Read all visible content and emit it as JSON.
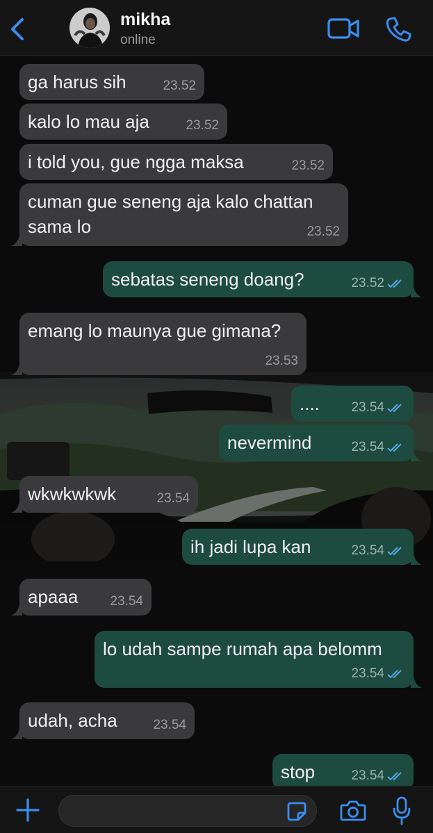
{
  "header": {
    "contact_name": "mikha",
    "status": "online"
  },
  "messages": [
    {
      "dir": "in",
      "text": "ga harus sih",
      "time": "23.52"
    },
    {
      "dir": "in",
      "text": "kalo lo mau aja",
      "time": "23.52"
    },
    {
      "dir": "in",
      "text": "i told you, gue ngga maksa",
      "time": "23.52"
    },
    {
      "dir": "in",
      "text": "cuman gue seneng aja kalo chattan\nsama lo",
      "time": "23.52"
    },
    {
      "dir": "out",
      "text": "sebatas seneng doang?",
      "time": "23.52",
      "read": true
    },
    {
      "dir": "in",
      "text": "emang lo maunya gue gimana?",
      "time": "23.53"
    },
    {
      "dir": "out",
      "text": "....",
      "time": "23.54",
      "read": true
    },
    {
      "dir": "out",
      "text": "nevermind",
      "time": "23.54",
      "read": true
    },
    {
      "dir": "in",
      "text": "wkwkwkwk",
      "time": "23.54"
    },
    {
      "dir": "out",
      "text": "ih jadi lupa kan",
      "time": "23.54",
      "read": true
    },
    {
      "dir": "in",
      "text": "apaaa",
      "time": "23.54"
    },
    {
      "dir": "out",
      "text": "lo udah sampe rumah apa belomm",
      "time": "23.54",
      "read": true
    },
    {
      "dir": "in",
      "text": "udah, acha",
      "time": "23.54"
    },
    {
      "dir": "out",
      "text": "stop",
      "time": "23.54",
      "read": true
    }
  ],
  "input": {
    "value": "",
    "placeholder": ""
  },
  "icons": {
    "back": "chevron-left-icon",
    "video": "video-call-icon",
    "call": "phone-icon",
    "plus": "plus-icon",
    "sticker": "sticker-icon",
    "camera": "camera-icon",
    "mic": "microphone-icon"
  },
  "colors": {
    "accent": "#3b8ef0",
    "incoming_bubble": "#3a3a3c",
    "outgoing_bubble": "#1e4b3f",
    "read_tick": "#53a6e8",
    "background": "#0b0b0b"
  }
}
